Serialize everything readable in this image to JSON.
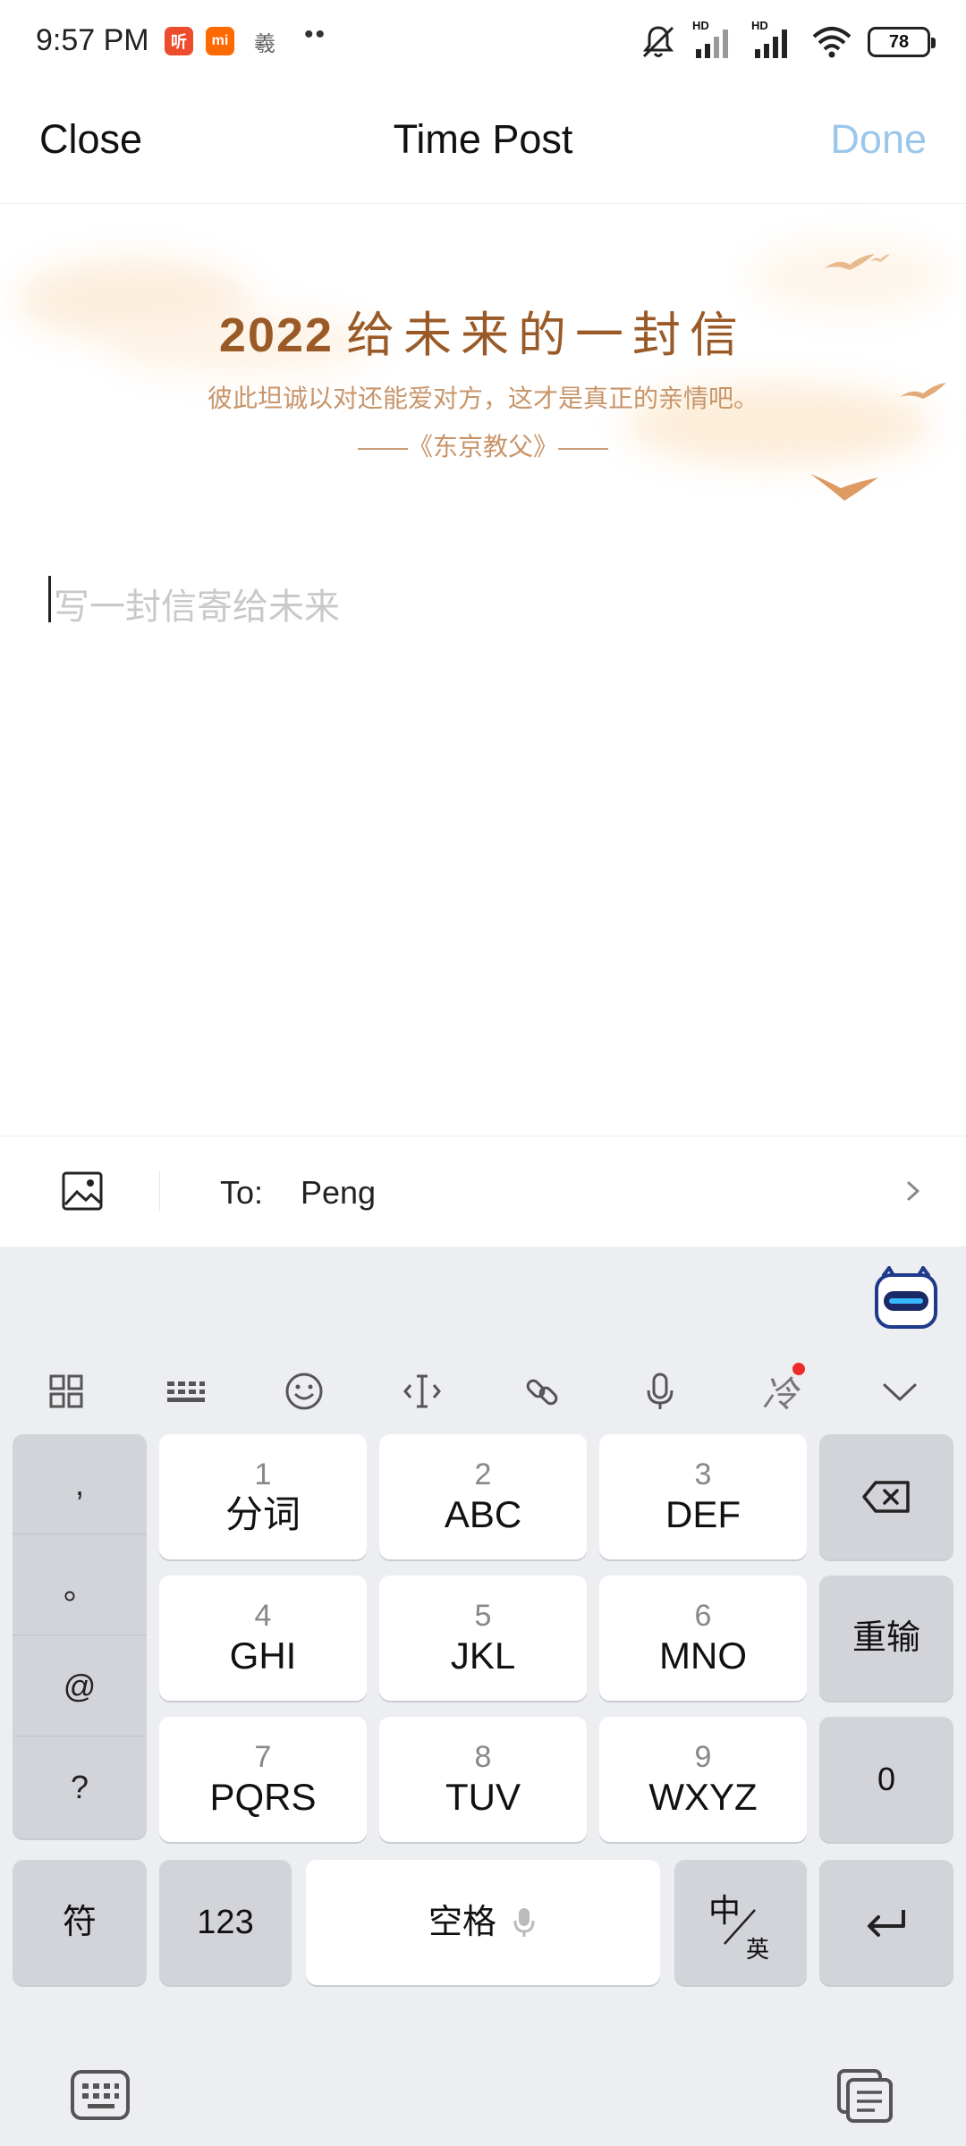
{
  "status_bar": {
    "time": "9:57 PM",
    "app_icons": [
      {
        "name": "listen-app-icon",
        "glyph": "听",
        "color": "#ee4d2d"
      },
      {
        "name": "mi-app-icon",
        "glyph": "mi",
        "color": "#ff6a00"
      },
      {
        "name": "feather-app-icon",
        "glyph": "羲",
        "color": "#666666"
      }
    ],
    "more_dots": "••",
    "signal_label_1": "HD",
    "signal_label_2": "HD",
    "battery": "78"
  },
  "header": {
    "close_label": "Close",
    "title": "Time Post",
    "done_label": "Done",
    "done_color": "#9cc7ec"
  },
  "banner": {
    "year": "2022",
    "heading": "给未来的一封信",
    "quote": "彼此坦诚以对还能爱对方，这才是真正的亲情吧。",
    "source": "——《东京教父》——",
    "accent_color": "#9a5a27"
  },
  "editor": {
    "placeholder": "写一封信寄给未来"
  },
  "recipient": {
    "label": "To:",
    "value": "Peng"
  },
  "keyboard": {
    "toolbar_icons": [
      "grid-icon",
      "keyboard-icon",
      "emoji-icon",
      "cursor-icon",
      "link-icon",
      "microphone-icon",
      "cold-font-icon",
      "collapse-keyboard-icon"
    ],
    "toolbar_glyph_cold": "冷",
    "punctuation": [
      ",",
      "。",
      "@",
      "?"
    ],
    "keys": [
      {
        "num": "1",
        "label": "分词"
      },
      {
        "num": "2",
        "label": "ABC"
      },
      {
        "num": "3",
        "label": "DEF"
      },
      {
        "num": "4",
        "label": "GHI"
      },
      {
        "num": "5",
        "label": "JKL"
      },
      {
        "num": "6",
        "label": "MNO"
      },
      {
        "num": "7",
        "label": "PQRS"
      },
      {
        "num": "8",
        "label": "TUV"
      },
      {
        "num": "9",
        "label": "WXYZ"
      }
    ],
    "retype_label": "重输",
    "zero_label": "0",
    "symbols_label": "符",
    "numbers_label": "123",
    "space_label": "空格",
    "lang_top": "中",
    "lang_bottom": "英"
  }
}
